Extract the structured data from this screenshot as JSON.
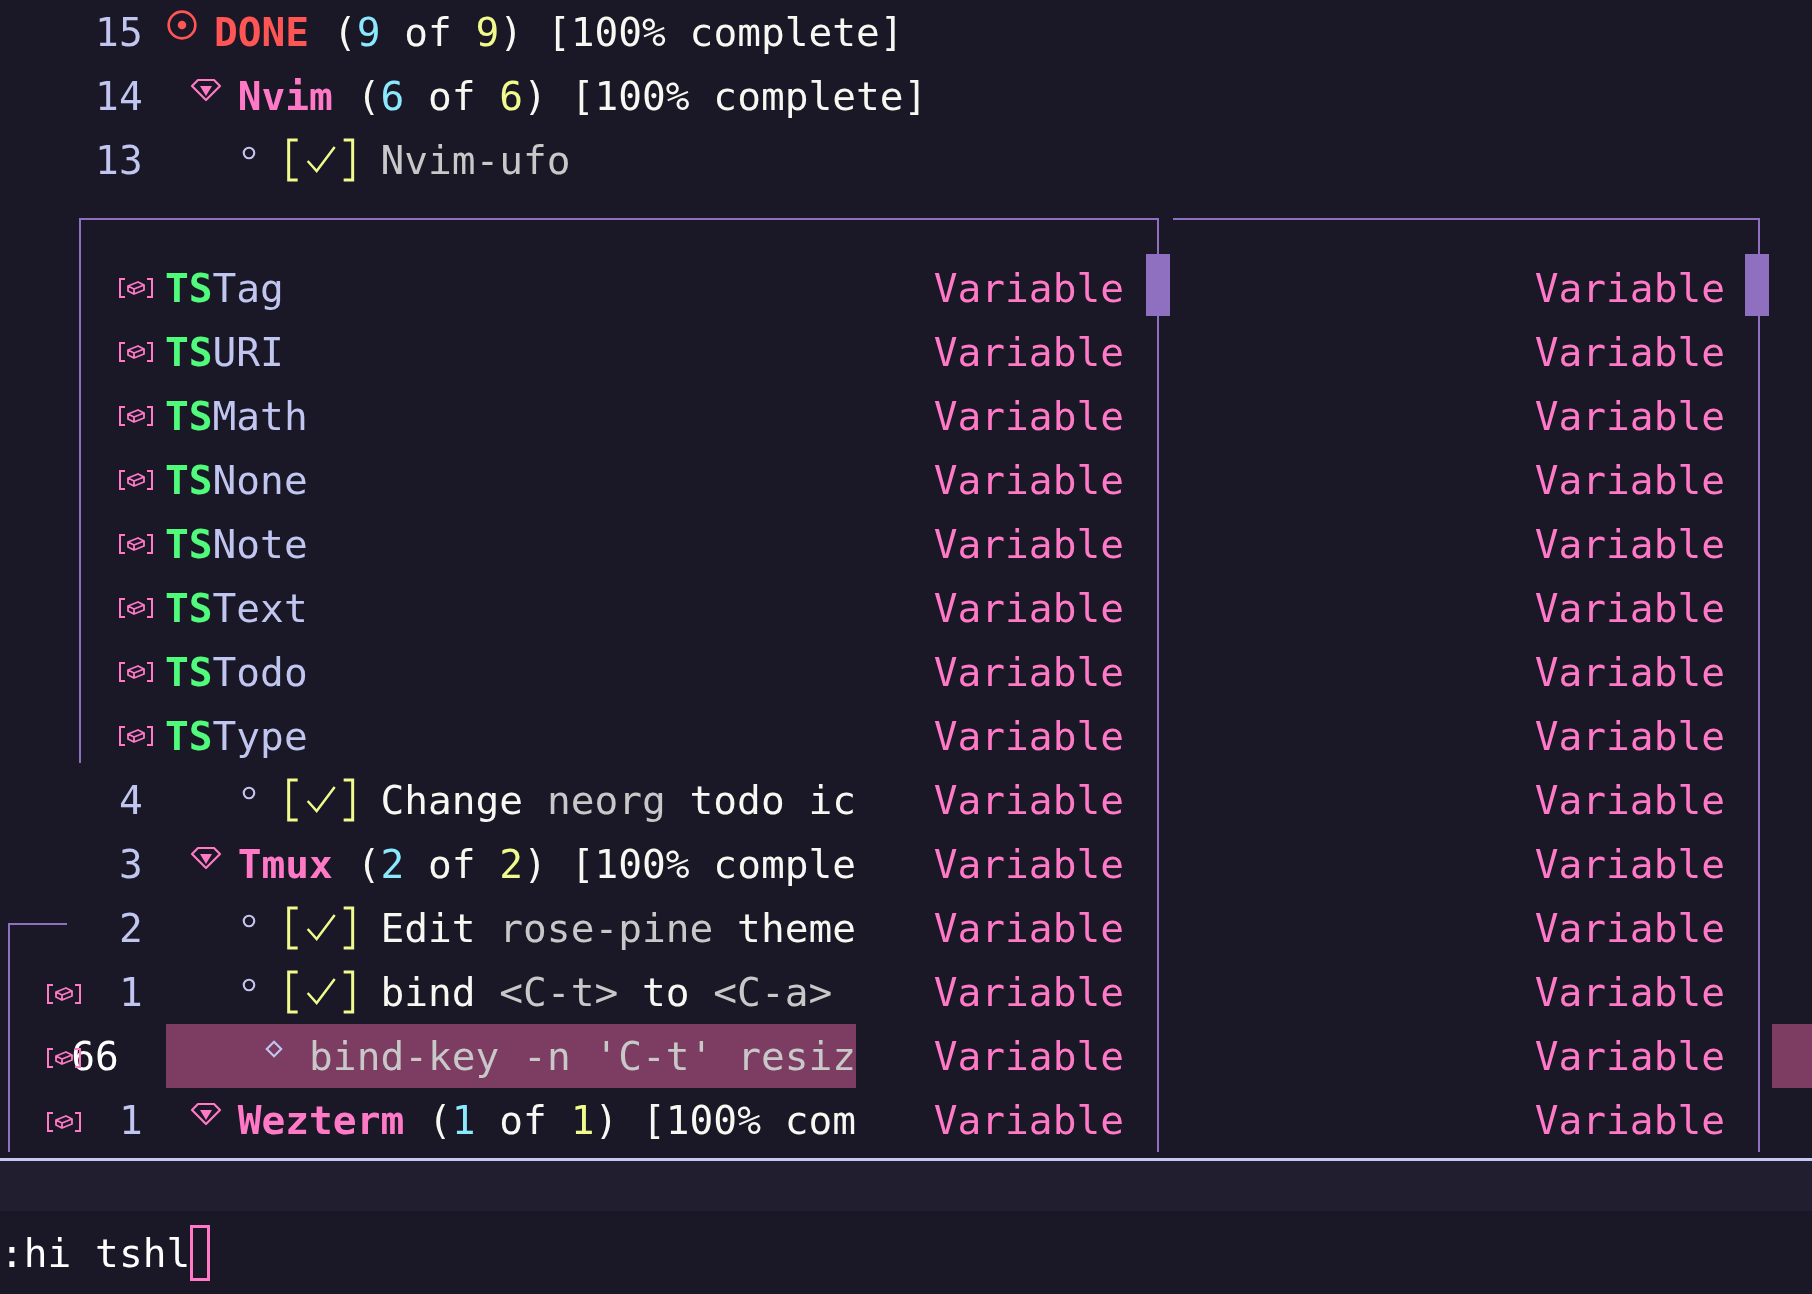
{
  "buffer": {
    "lines_above": [
      {
        "number": "15",
        "kind": "heading1",
        "current": false,
        "title": "DONE",
        "segments": [
          {
            "text": " (",
            "kind": "text"
          },
          {
            "text": "9",
            "kind": "done"
          },
          {
            "text": " of ",
            "kind": "text"
          },
          {
            "text": "9",
            "kind": "total"
          },
          {
            "text": ") [100% complete]",
            "kind": "text"
          }
        ]
      },
      {
        "number": "14",
        "kind": "heading2",
        "current": false,
        "title": "Nvim",
        "segments": [
          {
            "text": " (",
            "kind": "text"
          },
          {
            "text": "6",
            "kind": "done"
          },
          {
            "text": " of ",
            "kind": "text"
          },
          {
            "text": "6",
            "kind": "total"
          },
          {
            "text": ") [100% complete]",
            "kind": "text"
          }
        ]
      },
      {
        "number": "13",
        "kind": "task",
        "current": false,
        "checked": true,
        "segments": [
          {
            "text": "Nvim-ufo",
            "kind": "muted"
          }
        ]
      }
    ],
    "lines_below": [
      {
        "number": "4",
        "kind": "task",
        "current": false,
        "checked": true,
        "segments": [
          {
            "text": "Change ",
            "kind": "text"
          },
          {
            "text": "neorg",
            "kind": "muted"
          },
          {
            "text": " todo ic",
            "kind": "text"
          }
        ]
      },
      {
        "number": "3",
        "kind": "heading2",
        "current": false,
        "title": "Tmux",
        "segments": [
          {
            "text": " (",
            "kind": "text"
          },
          {
            "text": "2",
            "kind": "done"
          },
          {
            "text": " of ",
            "kind": "text"
          },
          {
            "text": "2",
            "kind": "total"
          },
          {
            "text": ") [100% comple",
            "kind": "text"
          }
        ]
      },
      {
        "number": "2",
        "kind": "task",
        "current": false,
        "checked": true,
        "segments": [
          {
            "text": "Edit ",
            "kind": "text"
          },
          {
            "text": "rose-pine",
            "kind": "muted"
          },
          {
            "text": " theme",
            "kind": "text"
          }
        ]
      },
      {
        "number": "1",
        "kind": "task",
        "current": false,
        "checked": true,
        "segments": [
          {
            "text": "bind ",
            "kind": "text"
          },
          {
            "text": "<C-t>",
            "kind": "muted"
          },
          {
            "text": " to ",
            "kind": "text"
          },
          {
            "text": "<C-a>",
            "kind": "muted"
          }
        ]
      },
      {
        "number": "66",
        "kind": "code",
        "current": true,
        "segments": [
          {
            "text": "bind-key -n 'C-t' resiz",
            "kind": "muted"
          }
        ]
      },
      {
        "number": "1",
        "kind": "heading2",
        "current": false,
        "title": "Wezterm",
        "segments": [
          {
            "text": " (",
            "kind": "text"
          },
          {
            "text": "1",
            "kind": "done"
          },
          {
            "text": " of ",
            "kind": "text"
          },
          {
            "text": "1",
            "kind": "total"
          },
          {
            "text": ") [100% com",
            "kind": "text"
          }
        ]
      }
    ]
  },
  "completion_menus": [
    {
      "items": [
        {
          "match": "TS",
          "rest": "Tag",
          "type_label": "Variable"
        },
        {
          "match": "TS",
          "rest": "URI",
          "type_label": "Variable"
        },
        {
          "match": "TS",
          "rest": "Math",
          "type_label": "Variable"
        },
        {
          "match": "TS",
          "rest": "None",
          "type_label": "Variable"
        },
        {
          "match": "TS",
          "rest": "Note",
          "type_label": "Variable"
        },
        {
          "match": "TS",
          "rest": "Text",
          "type_label": "Variable"
        },
        {
          "match": "TS",
          "rest": "Todo",
          "type_label": "Variable"
        },
        {
          "match": "TS",
          "rest": "Type",
          "type_label": "Variable"
        },
        {
          "type_label": "Variable"
        },
        {
          "type_label": "Variable"
        },
        {
          "type_label": "Variable"
        },
        {
          "type_label": "Variable"
        },
        {
          "type_label": "Variable"
        },
        {
          "type_label": "Variable"
        }
      ]
    },
    {
      "items": [
        {
          "type_label": "Variable"
        },
        {
          "type_label": "Variable"
        },
        {
          "type_label": "Variable"
        },
        {
          "type_label": "Variable"
        },
        {
          "type_label": "Variable"
        },
        {
          "type_label": "Variable"
        },
        {
          "type_label": "Variable"
        },
        {
          "type_label": "Variable"
        },
        {
          "type_label": "Variable"
        },
        {
          "type_label": "Variable"
        },
        {
          "type_label": "Variable"
        },
        {
          "type_label": "Variable"
        },
        {
          "type_label": "Variable"
        },
        {
          "type_label": "Variable"
        }
      ]
    }
  ],
  "cmdline": {
    "text": ":hi tshl"
  }
}
